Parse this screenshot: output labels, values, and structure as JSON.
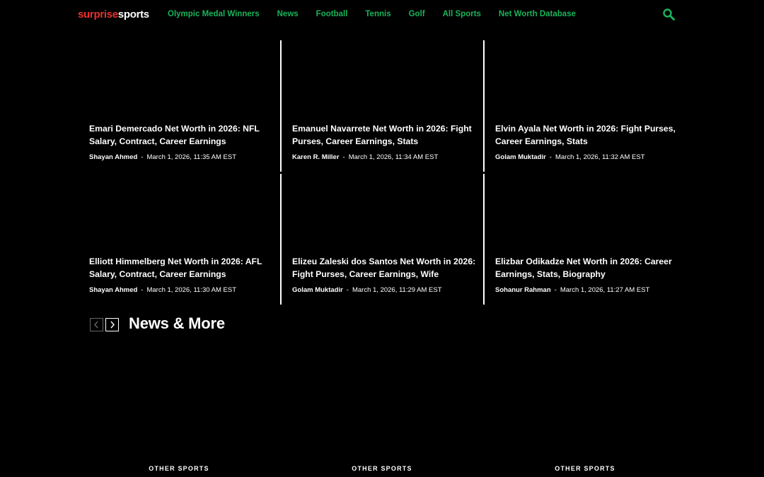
{
  "brand": {
    "logo_part1": "surprise",
    "logo_part2": "sports",
    "accent": "#e8312f",
    "nav_color": "#19b35a"
  },
  "nav": {
    "items": [
      {
        "label": "Olympic Medal Winners"
      },
      {
        "label": "News"
      },
      {
        "label": "Football"
      },
      {
        "label": "Tennis"
      },
      {
        "label": "Golf"
      },
      {
        "label": "All Sports"
      },
      {
        "label": "Net Worth Database"
      }
    ],
    "search_icon": "search-icon"
  },
  "articles": [
    {
      "title": "Emari Demercado Net Worth in 2026: NFL Salary, Contract, Career Earnings",
      "author": "Shayan Ahmed",
      "sep": "-",
      "date": "March 1, 2026, 11:35 AM EST"
    },
    {
      "title": "Emanuel Navarrete Net Worth in 2026: Fight Purses, Career Earnings, Stats",
      "author": "Karen R. Miller",
      "sep": "-",
      "date": "March 1, 2026, 11:34 AM EST"
    },
    {
      "title": "Elvin Ayala Net Worth in 2026: Fight Purses, Career Earnings, Stats",
      "author": "Golam Muktadir",
      "sep": "-",
      "date": "March 1, 2026, 11:32 AM EST"
    },
    {
      "title": "Elliott Himmelberg Net Worth in 2026: AFL Salary, Contract, Career Earnings",
      "author": "Shayan Ahmed",
      "sep": "-",
      "date": "March 1, 2026, 11:30 AM EST"
    },
    {
      "title": "Elizeu Zaleski dos Santos Net Worth in 2026: Fight Purses, Career Earnings, Wife",
      "author": "Golam Muktadir",
      "sep": "-",
      "date": "March 1, 2026, 11:29 AM EST"
    },
    {
      "title": "Elizbar Odikadze Net Worth in 2026: Career Earnings, Stats, Biography",
      "author": "Sohanur Rahman",
      "sep": "-",
      "date": "March 1, 2026, 11:27 AM EST"
    }
  ],
  "news_section": {
    "title": "News & More",
    "prev_icon": "chevron-left-icon",
    "next_icon": "chevron-right-icon",
    "categories": [
      "OTHER SPORTS",
      "OTHER SPORTS",
      "OTHER SPORTS"
    ]
  }
}
